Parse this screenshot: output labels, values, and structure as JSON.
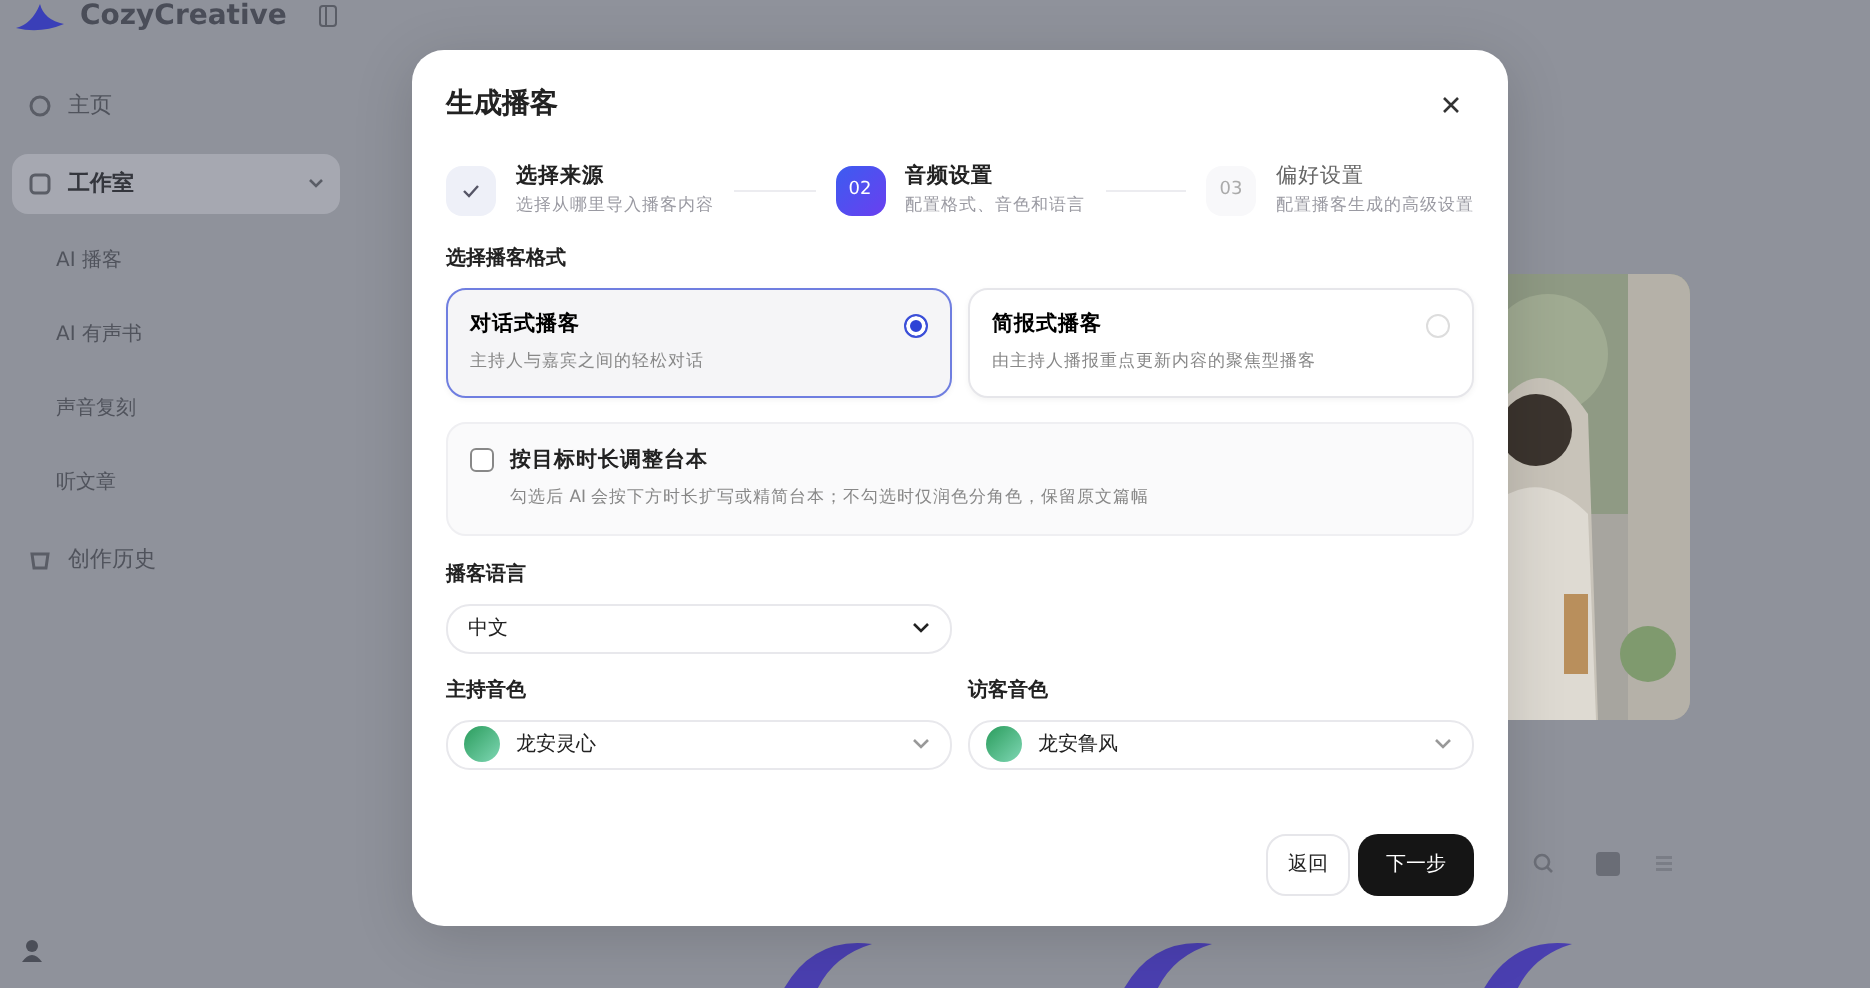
{
  "app": {
    "logo": "CozyCreative",
    "nav": [
      {
        "label": "主页",
        "kind": "item",
        "selected": false
      },
      {
        "label": "工作室",
        "kind": "group",
        "selected": true,
        "expanded": true,
        "children": [
          {
            "label": "AI 播客"
          },
          {
            "label": "AI 有声书"
          },
          {
            "label": "声音复刻"
          },
          {
            "label": "听文章"
          }
        ]
      },
      {
        "label": "创作历史",
        "kind": "item",
        "selected": false
      }
    ]
  },
  "dialog": {
    "title": "生成播客",
    "steps": [
      {
        "kind": "done",
        "title": "选择来源",
        "subtitle": "选择从哪里导入播客内容"
      },
      {
        "kind": "current",
        "number": "02",
        "title": "音频设置",
        "subtitle": "配置格式、音色和语言"
      },
      {
        "kind": "pending",
        "number": "03",
        "title": "偏好设置",
        "subtitle": "配置播客生成的高级设置"
      }
    ],
    "format_label": "选择播客格式",
    "formats": [
      {
        "title": "对话式播客",
        "description": "主持人与嘉宾之间的轻松对话",
        "selected": true
      },
      {
        "title": "简报式播客",
        "description": "由主持人播报重点更新内容的聚焦型播客",
        "selected": false
      }
    ],
    "option": {
      "label": "按目标时长调整台本",
      "hint": "勾选后 AI 会按下方时长扩写或精简台本；不勾选时仅润色分角色，保留原文篇幅",
      "checked": false
    },
    "language": {
      "label": "播客语言",
      "value": "中文"
    },
    "voices": [
      {
        "label": "主持音色",
        "value": "龙安灵心"
      },
      {
        "label": "访客音色",
        "value": "龙安鲁风"
      }
    ],
    "buttons": {
      "back": "返回",
      "next": "下一步"
    }
  }
}
